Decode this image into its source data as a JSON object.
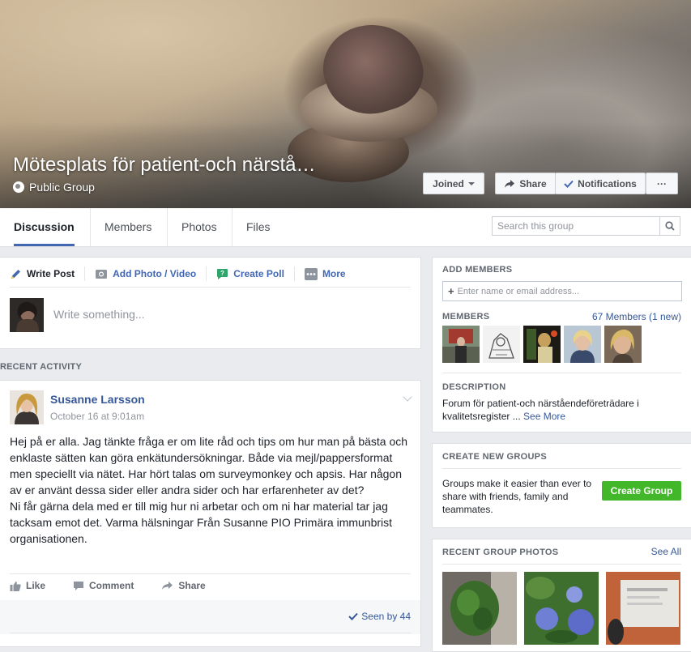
{
  "cover": {
    "title": "Mötesplats för patient-och närstå…",
    "privacy": "Public Group",
    "joined_label": "Joined",
    "share_label": "Share",
    "notifications_label": "Notifications",
    "more_label": "···"
  },
  "tabs": [
    {
      "label": "Discussion",
      "active": true
    },
    {
      "label": "Members",
      "active": false
    },
    {
      "label": "Photos",
      "active": false
    },
    {
      "label": "Files",
      "active": false
    }
  ],
  "search": {
    "placeholder": "Search this group"
  },
  "composer": {
    "actions": [
      "Write Post",
      "Add Photo / Video",
      "Create Poll",
      "More"
    ],
    "placeholder": "Write something..."
  },
  "recent_activity_label": "RECENT ACTIVITY",
  "post": {
    "author": "Susanne Larsson",
    "time": "October 16 at 9:01am",
    "body": "Hej på er alla. Jag tänkte fråga er om lite råd och tips om hur man på bästa och enklaste sätten kan göra enkätundersökningar. Både via mejl/pappersformat men speciellt via nätet. Har hört talas om surveymonkey och apsis. Har någon av er använt dessa sider eller andra sider och har erfarenheter av det?\nNi får gärna dela med er till mig hur ni arbetar och om ni har material tar jag tacksam emot det. Varma hälsningar Från Susanne PIO Primära immunbrist organisationen.",
    "like_label": "Like",
    "comment_label": "Comment",
    "share_label": "Share",
    "seen_label": "Seen by 44"
  },
  "sidebar": {
    "add_members_label": "ADD MEMBERS",
    "add_members_placeholder": "Enter name or email address...",
    "members_label": "MEMBERS",
    "members_link": "67 Members (1 new)",
    "description_label": "DESCRIPTION",
    "description_text": "Forum för patient-och närståendeföreträdare i kvalitetsregister ...",
    "see_more": "See More",
    "create_groups_label": "CREATE NEW GROUPS",
    "create_groups_text": "Groups make it easier than ever to share with friends, family and teammates.",
    "create_group_button": "Create Group",
    "recent_photos_label": "RECENT GROUP PHOTOS",
    "see_all": "See All"
  },
  "colors": {
    "brand_blue": "#4267b2",
    "link_blue": "#365899",
    "green": "#42b72a",
    "poll_green": "#2ea56a",
    "background": "#e9ebee"
  }
}
